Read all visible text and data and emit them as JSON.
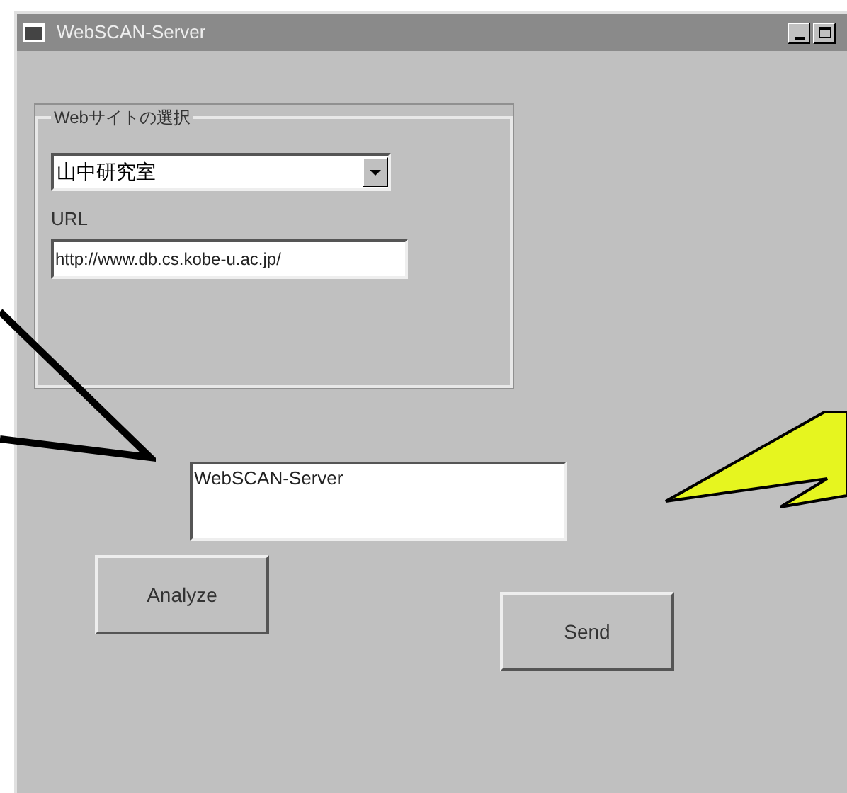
{
  "window": {
    "title": "WebSCAN-Server"
  },
  "group": {
    "legend": "Webサイトの選択",
    "site_select": {
      "value": "山中研究室"
    },
    "url_label": "URL",
    "url_field": {
      "value": "http://www.db.cs.kobe-u.ac.jp/"
    }
  },
  "output_field": {
    "value": "WebSCAN-Server"
  },
  "buttons": [
    {
      "label": "Analyze"
    },
    {
      "label": "Send"
    }
  ]
}
